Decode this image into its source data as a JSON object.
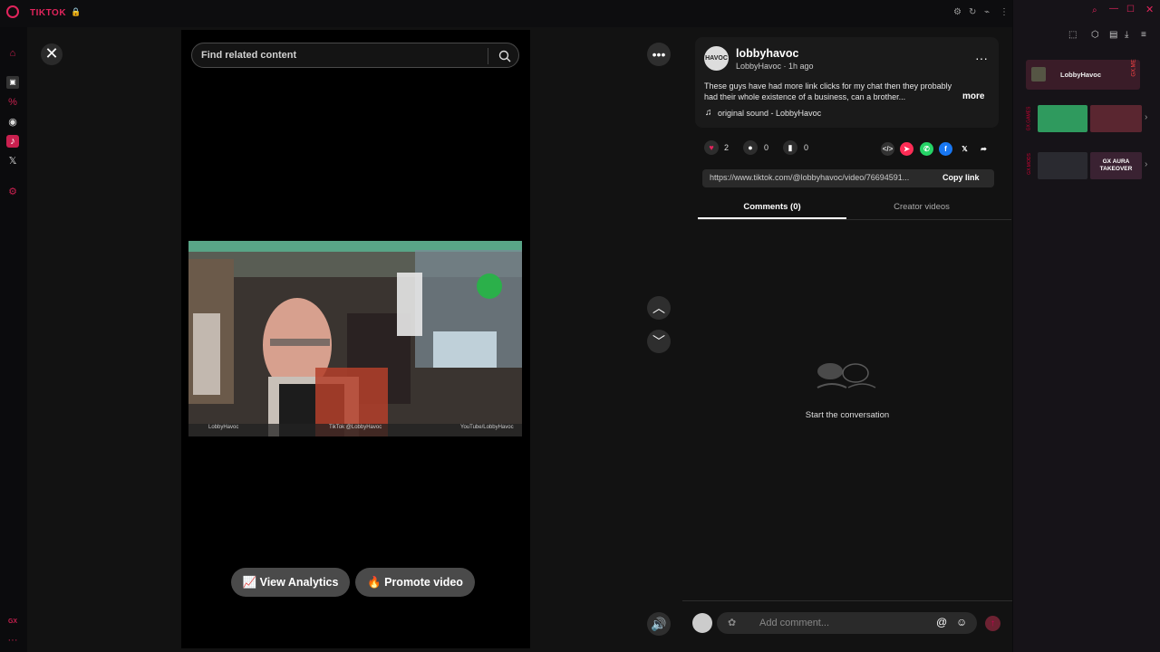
{
  "browser": {
    "tab_title": "TIKTOK",
    "lock_icon": "lock-icon"
  },
  "search": {
    "placeholder": "Find related content"
  },
  "video": {
    "view_analytics_label": "View Analytics",
    "promote_video_label": "Promote video",
    "overlay_left": "LobbyHavoc",
    "overlay_mid": "TikTok @LobbyHavoc",
    "overlay_right": "YouTube/LobbyHavoc"
  },
  "post": {
    "username": "lobbyhavoc",
    "display_name_time": "LobbyHavoc · 1h ago",
    "avatar_text": "HAVOC",
    "caption": "These guys have had more link clicks for my chat then they probably had their whole existence of a business, can a brother...",
    "more_label": "more",
    "sound": "original sound - LobbyHavoc",
    "likes": "2",
    "comments": "0",
    "saves": "0",
    "link_url": "https://www.tiktok.com/@lobbyhavoc/video/76694591...",
    "copy_link_label": "Copy link"
  },
  "tabs": {
    "comments_label": "Comments (0)",
    "creator_label": "Creator videos"
  },
  "empty_state": {
    "text": "Start the conversation"
  },
  "comment": {
    "placeholder": "Add comment..."
  },
  "gx_panel": {
    "user_label": "LobbyHavoc",
    "me_tag": "GX.ME",
    "games_tag": "GX.GAMES",
    "mods_tag": "GX.MODS",
    "aura_text": "GX AURA TAKEOVER"
  },
  "sidebar_bottom": {
    "gx_label": "GX"
  },
  "colors": {
    "accent": "#e1245c",
    "background": "#121212",
    "video_bg": "#000000",
    "panel": "#1a1a1a"
  }
}
